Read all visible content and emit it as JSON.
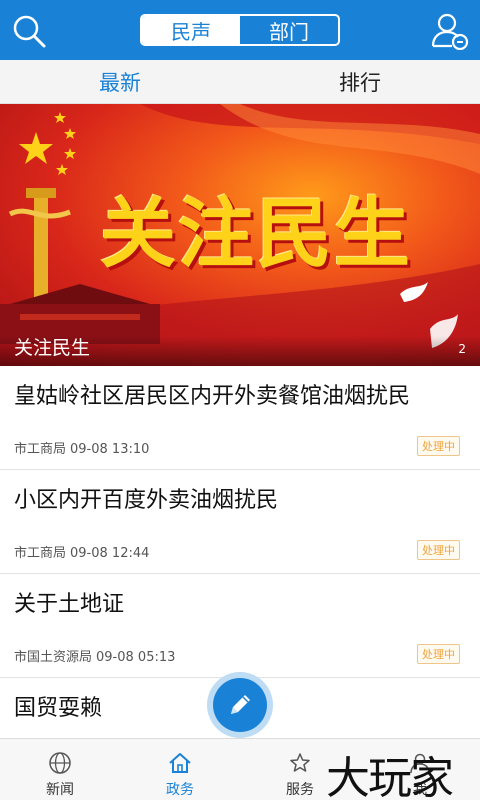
{
  "header": {
    "segments": [
      "民声",
      "部门"
    ],
    "active_segment": 0
  },
  "subtabs": [
    "最新",
    "排行"
  ],
  "banner": {
    "title": "关注民生",
    "caption": "关注民生",
    "page_indicator": "2"
  },
  "items": [
    {
      "title": "皇姑岭社区居民区内开外卖餐馆油烟扰民",
      "dept": "市工商局",
      "time": "09-08 13:10",
      "status": "处理中"
    },
    {
      "title": "小区内开百度外卖油烟扰民",
      "dept": "市工商局",
      "time": "09-08 12:44",
      "status": "处理中"
    },
    {
      "title": "关于土地证",
      "dept": "市国土资源局",
      "time": "09-08 05:13",
      "status": "处理中"
    },
    {
      "title": "国贸耍赖"
    }
  ],
  "bottom_nav": [
    {
      "label": "新闻",
      "icon": "globe-icon"
    },
    {
      "label": "政务",
      "icon": "house-icon"
    },
    {
      "label": "服务",
      "icon": "star-icon"
    },
    {
      "label": "我",
      "icon": "person-icon"
    }
  ],
  "watermark": "大玩家",
  "colors": {
    "primary": "#1a82d6",
    "status": "#f0a43c",
    "banner_text": "#ffd21a"
  }
}
